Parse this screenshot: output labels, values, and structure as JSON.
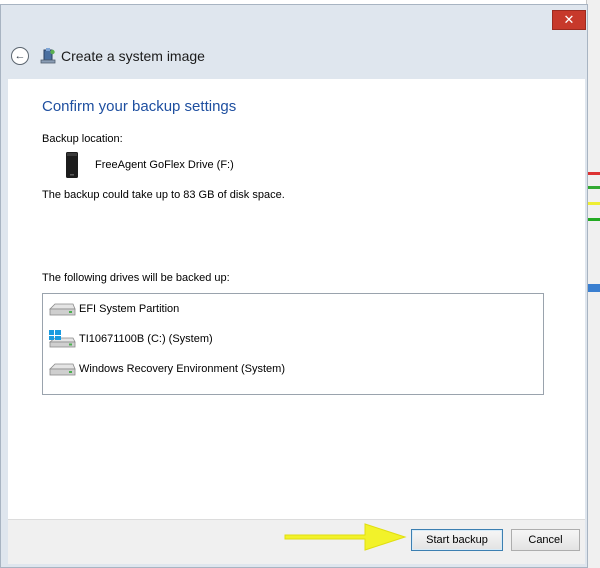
{
  "window": {
    "title": "Create a system image",
    "close_glyph": "✕",
    "back_glyph": "←"
  },
  "content": {
    "heading": "Confirm your backup settings",
    "backup_location_label": "Backup location:",
    "backup_location_drive": "FreeAgent GoFlex Drive (F:)",
    "space_text": "The backup could take up to 83 GB of disk space.",
    "drives_label": "The following drives will be backed up:",
    "drives": [
      {
        "label": "EFI System Partition",
        "icon": "hard-drive-icon"
      },
      {
        "label": "TI10671100B (C:) (System)",
        "icon": "windows-drive-icon"
      },
      {
        "label": "Windows Recovery Environment (System)",
        "icon": "hard-drive-icon"
      }
    ]
  },
  "footer": {
    "start_label": "Start backup",
    "cancel_label": "Cancel"
  },
  "colors": {
    "heading": "#1e4fa0",
    "close": "#c7392b",
    "annotation_arrow": "#f2f22a"
  }
}
